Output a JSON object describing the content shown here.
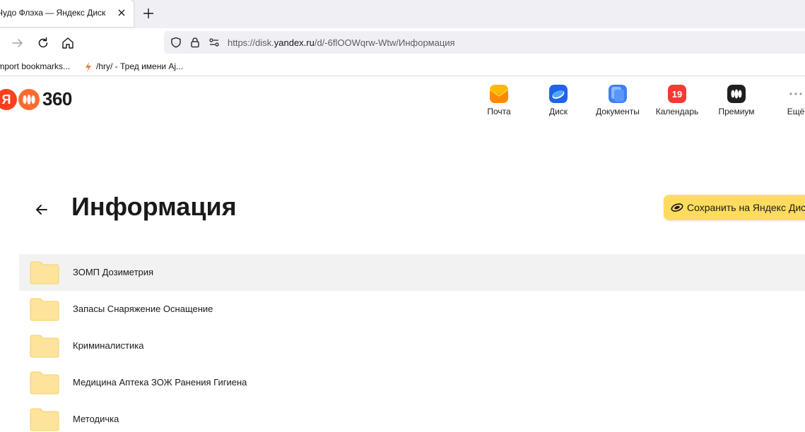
{
  "browser": {
    "tab_title": "Чудо Флэха — Яндекс Диск",
    "url_prefix": "https://disk.",
    "url_host": "yandex.ru",
    "url_path": "/d/-6flOOWqrw-Wtw/Информация",
    "bookmarks": [
      {
        "label": "Import bookmarks..."
      },
      {
        "label": "/hry/ - Тред имени Aj..."
      }
    ]
  },
  "header": {
    "logo_letter": "Я",
    "logo_number": "360",
    "services": [
      {
        "label": "Почта",
        "icon": "mail-icon",
        "color": "#ff9d00"
      },
      {
        "label": "Диск",
        "icon": "disk-icon",
        "color": "#1e63e9"
      },
      {
        "label": "Документы",
        "icon": "documents-icon",
        "color": "#3d7ff5"
      },
      {
        "label": "Календарь",
        "icon": "calendar-icon",
        "color": "#f33a33",
        "badge": "19"
      },
      {
        "label": "Премиум",
        "icon": "premium-icon",
        "color": "#1f1f1f"
      },
      {
        "label": "Ещё",
        "icon": "more-icon",
        "color": "#9a9a9a"
      }
    ]
  },
  "main": {
    "title": "Информация",
    "save_button": "Сохранить на Яндекс Диск",
    "folders": [
      {
        "name": "ЗОМП Дозиметрия",
        "selected": true
      },
      {
        "name": "Запасы Снаряжение Оснащение",
        "selected": false
      },
      {
        "name": "Криминалистика",
        "selected": false
      },
      {
        "name": "Медицина Аптека ЗОЖ Ранения Гигиена",
        "selected": false
      },
      {
        "name": "Методичка",
        "selected": false
      }
    ]
  },
  "colors": {
    "accent_yellow": "#ffdc60",
    "folder_fill": "#fde49a",
    "selected_row": "#f2f2f2"
  }
}
